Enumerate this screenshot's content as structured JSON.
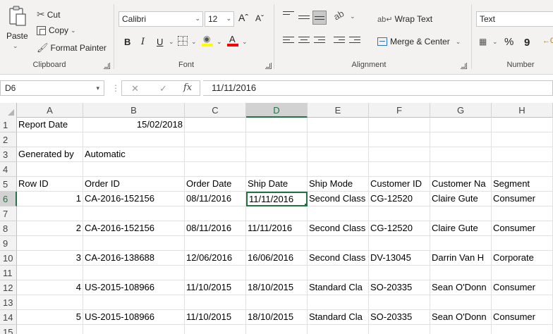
{
  "clipboard": {
    "paste_label": "Paste",
    "cut_label": "Cut",
    "copy_label": "Copy",
    "format_painter_label": "Format Painter",
    "group_label": "Clipboard"
  },
  "font": {
    "font_name": "Calibri",
    "font_size": "12",
    "bold_label": "B",
    "italic_label": "I",
    "underline_label": "U",
    "grow_label": "Aˆ",
    "shrink_label": "Aˇ",
    "font_color_label": "A",
    "group_label": "Font",
    "fill_color": "#ffff00",
    "font_color": "#ff0000"
  },
  "alignment": {
    "wrap_text_label": "Wrap Text",
    "merge_center_label": "Merge & Center",
    "group_label": "Alignment"
  },
  "number": {
    "format_value": "Text",
    "percent_label": "%",
    "comma_label": "9",
    "group_label": "Number"
  },
  "formula_bar": {
    "name_box": "D6",
    "formula": "11/11/2016"
  },
  "columns": [
    "A",
    "B",
    "C",
    "D",
    "E",
    "F",
    "G",
    "H"
  ],
  "selected_column": "D",
  "selected_row": "6",
  "rows": [
    {
      "num": "1",
      "cells": [
        "Report Date",
        "15/02/2018",
        "",
        "",
        "",
        "",
        "",
        ""
      ]
    },
    {
      "num": "2",
      "cells": [
        "",
        "",
        "",
        "",
        "",
        "",
        "",
        ""
      ]
    },
    {
      "num": "3",
      "cells": [
        "Generated by",
        "Automatic",
        "",
        "",
        "",
        "",
        "",
        ""
      ]
    },
    {
      "num": "4",
      "cells": [
        "",
        "",
        "",
        "",
        "",
        "",
        "",
        ""
      ]
    },
    {
      "num": "5",
      "cells": [
        "Row ID",
        "Order ID",
        "Order Date",
        "Ship Date",
        "Ship Mode",
        "Customer ID",
        "Customer Na",
        "Segment"
      ]
    },
    {
      "num": "6",
      "cells": [
        "1",
        "CA-2016-152156",
        "08/11/2016",
        "11/11/2016",
        "Second Class",
        "CG-12520",
        "Claire Gute",
        "Consumer"
      ]
    },
    {
      "num": "7",
      "cells": [
        "",
        "",
        "",
        "",
        "",
        "",
        "",
        ""
      ]
    },
    {
      "num": "8",
      "cells": [
        "2",
        "CA-2016-152156",
        "08/11/2016",
        "11/11/2016",
        "Second Class",
        "CG-12520",
        "Claire Gute",
        "Consumer"
      ]
    },
    {
      "num": "9",
      "cells": [
        "",
        "",
        "",
        "",
        "",
        "",
        "",
        ""
      ]
    },
    {
      "num": "10",
      "cells": [
        "3",
        "CA-2016-138688",
        "12/06/2016",
        "16/06/2016",
        "Second Class",
        "DV-13045",
        "Darrin Van H",
        "Corporate"
      ]
    },
    {
      "num": "11",
      "cells": [
        "",
        "",
        "",
        "",
        "",
        "",
        "",
        ""
      ]
    },
    {
      "num": "12",
      "cells": [
        "4",
        "US-2015-108966",
        "11/10/2015",
        "18/10/2015",
        "Standard Cla",
        "SO-20335",
        "Sean O'Donn",
        "Consumer"
      ]
    },
    {
      "num": "13",
      "cells": [
        "",
        "",
        "",
        "",
        "",
        "",
        "",
        ""
      ]
    },
    {
      "num": "14",
      "cells": [
        "5",
        "US-2015-108966",
        "11/10/2015",
        "18/10/2015",
        "Standard Cla",
        "SO-20335",
        "Sean O'Donn",
        "Consumer"
      ]
    },
    {
      "num": "15",
      "cells": [
        "",
        "",
        "",
        "",
        "",
        "",
        "",
        ""
      ]
    }
  ],
  "colors": {
    "accent": "#217346",
    "ribbon_bg": "#f3f2f1"
  }
}
